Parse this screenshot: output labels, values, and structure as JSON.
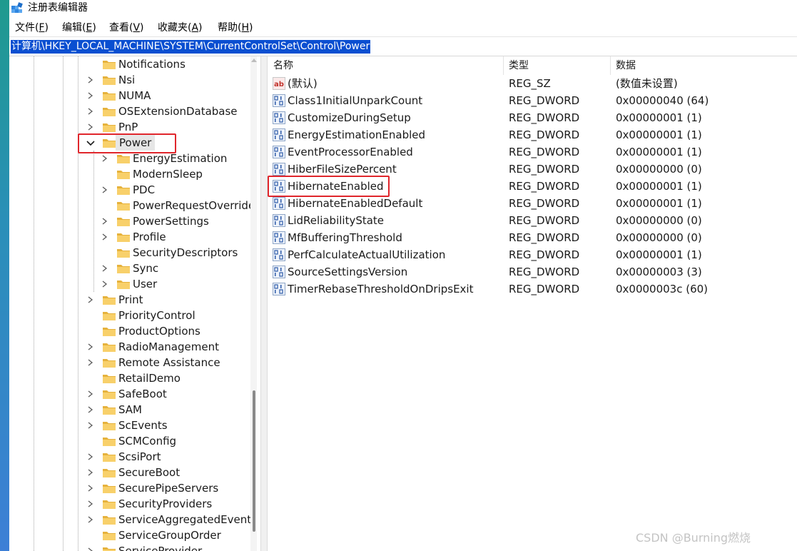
{
  "window": {
    "title": "注册表编辑器",
    "accent": "#0a4fd1",
    "highlight_color": "#e0262c"
  },
  "menu": {
    "items": [
      {
        "label": "文件(",
        "key": "F",
        "end": ")"
      },
      {
        "label": "编辑(",
        "key": "E",
        "end": ")"
      },
      {
        "label": "查看(",
        "key": "V",
        "end": ")"
      },
      {
        "label": "收藏夹(",
        "key": "A",
        "end": ")"
      },
      {
        "label": "帮助(",
        "key": "H",
        "end": ")"
      }
    ]
  },
  "address": {
    "path": "计算机\\HKEY_LOCAL_MACHINE\\SYSTEM\\CurrentControlSet\\Control\\Power"
  },
  "tree": {
    "nodes": [
      {
        "label": "Notifications",
        "level": 1,
        "expandable": false,
        "expanded": false,
        "selected": false
      },
      {
        "label": "Nsi",
        "level": 1,
        "expandable": true,
        "expanded": false,
        "selected": false
      },
      {
        "label": "NUMA",
        "level": 1,
        "expandable": true,
        "expanded": false,
        "selected": false
      },
      {
        "label": "OSExtensionDatabase",
        "level": 1,
        "expandable": true,
        "expanded": false,
        "selected": false
      },
      {
        "label": "PnP",
        "level": 1,
        "expandable": true,
        "expanded": false,
        "selected": false
      },
      {
        "label": "Power",
        "level": 1,
        "expandable": true,
        "expanded": true,
        "selected": true
      },
      {
        "label": "EnergyEstimation",
        "level": 2,
        "expandable": true,
        "expanded": false,
        "selected": false
      },
      {
        "label": "ModernSleep",
        "level": 2,
        "expandable": false,
        "expanded": false,
        "selected": false
      },
      {
        "label": "PDC",
        "level": 2,
        "expandable": true,
        "expanded": false,
        "selected": false
      },
      {
        "label": "PowerRequestOverride",
        "level": 2,
        "expandable": false,
        "expanded": false,
        "selected": false
      },
      {
        "label": "PowerSettings",
        "level": 2,
        "expandable": true,
        "expanded": false,
        "selected": false
      },
      {
        "label": "Profile",
        "level": 2,
        "expandable": true,
        "expanded": false,
        "selected": false
      },
      {
        "label": "SecurityDescriptors",
        "level": 2,
        "expandable": false,
        "expanded": false,
        "selected": false
      },
      {
        "label": "Sync",
        "level": 2,
        "expandable": true,
        "expanded": false,
        "selected": false
      },
      {
        "label": "User",
        "level": 2,
        "expandable": true,
        "expanded": false,
        "selected": false
      },
      {
        "label": "Print",
        "level": 1,
        "expandable": true,
        "expanded": false,
        "selected": false
      },
      {
        "label": "PriorityControl",
        "level": 1,
        "expandable": false,
        "expanded": false,
        "selected": false
      },
      {
        "label": "ProductOptions",
        "level": 1,
        "expandable": false,
        "expanded": false,
        "selected": false
      },
      {
        "label": "RadioManagement",
        "level": 1,
        "expandable": true,
        "expanded": false,
        "selected": false
      },
      {
        "label": "Remote Assistance",
        "level": 1,
        "expandable": true,
        "expanded": false,
        "selected": false
      },
      {
        "label": "RetailDemo",
        "level": 1,
        "expandable": false,
        "expanded": false,
        "selected": false
      },
      {
        "label": "SafeBoot",
        "level": 1,
        "expandable": true,
        "expanded": false,
        "selected": false
      },
      {
        "label": "SAM",
        "level": 1,
        "expandable": true,
        "expanded": false,
        "selected": false
      },
      {
        "label": "ScEvents",
        "level": 1,
        "expandable": true,
        "expanded": false,
        "selected": false
      },
      {
        "label": "SCMConfig",
        "level": 1,
        "expandable": false,
        "expanded": false,
        "selected": false
      },
      {
        "label": "ScsiPort",
        "level": 1,
        "expandable": true,
        "expanded": false,
        "selected": false
      },
      {
        "label": "SecureBoot",
        "level": 1,
        "expandable": true,
        "expanded": false,
        "selected": false
      },
      {
        "label": "SecurePipeServers",
        "level": 1,
        "expandable": true,
        "expanded": false,
        "selected": false
      },
      {
        "label": "SecurityProviders",
        "level": 1,
        "expandable": true,
        "expanded": false,
        "selected": false
      },
      {
        "label": "ServiceAggregatedEvents",
        "level": 1,
        "expandable": true,
        "expanded": false,
        "selected": false
      },
      {
        "label": "ServiceGroupOrder",
        "level": 1,
        "expandable": false,
        "expanded": false,
        "selected": false
      },
      {
        "label": "ServiceProvider",
        "level": 1,
        "expandable": true,
        "expanded": false,
        "selected": false
      }
    ]
  },
  "values": {
    "columns": {
      "name": "名称",
      "type": "类型",
      "data": "数据"
    },
    "rows": [
      {
        "icon": "string-value-icon",
        "name": "(默认)",
        "type": "REG_SZ",
        "data": "(数值未设置)",
        "highlighted": false
      },
      {
        "icon": "binary-value-icon",
        "name": "Class1InitialUnparkCount",
        "type": "REG_DWORD",
        "data": "0x00000040 (64)",
        "highlighted": false
      },
      {
        "icon": "binary-value-icon",
        "name": "CustomizeDuringSetup",
        "type": "REG_DWORD",
        "data": "0x00000001 (1)",
        "highlighted": false
      },
      {
        "icon": "binary-value-icon",
        "name": "EnergyEstimationEnabled",
        "type": "REG_DWORD",
        "data": "0x00000001 (1)",
        "highlighted": false
      },
      {
        "icon": "binary-value-icon",
        "name": "EventProcessorEnabled",
        "type": "REG_DWORD",
        "data": "0x00000001 (1)",
        "highlighted": false
      },
      {
        "icon": "binary-value-icon",
        "name": "HiberFileSizePercent",
        "type": "REG_DWORD",
        "data": "0x00000000 (0)",
        "highlighted": false
      },
      {
        "icon": "binary-value-icon",
        "name": "HibernateEnabled",
        "type": "REG_DWORD",
        "data": "0x00000001 (1)",
        "highlighted": true
      },
      {
        "icon": "binary-value-icon",
        "name": "HibernateEnabledDefault",
        "type": "REG_DWORD",
        "data": "0x00000001 (1)",
        "highlighted": false
      },
      {
        "icon": "binary-value-icon",
        "name": "LidReliabilityState",
        "type": "REG_DWORD",
        "data": "0x00000000 (0)",
        "highlighted": false
      },
      {
        "icon": "binary-value-icon",
        "name": "MfBufferingThreshold",
        "type": "REG_DWORD",
        "data": "0x00000000 (0)",
        "highlighted": false
      },
      {
        "icon": "binary-value-icon",
        "name": "PerfCalculateActualUtilization",
        "type": "REG_DWORD",
        "data": "0x00000001 (1)",
        "highlighted": false
      },
      {
        "icon": "binary-value-icon",
        "name": "SourceSettingsVersion",
        "type": "REG_DWORD",
        "data": "0x00000003 (3)",
        "highlighted": false
      },
      {
        "icon": "binary-value-icon",
        "name": "TimerRebaseThresholdOnDripsExit",
        "type": "REG_DWORD",
        "data": "0x0000003c (60)",
        "highlighted": false
      }
    ]
  },
  "watermark": {
    "text": "CSDN @Burning燃烧"
  }
}
